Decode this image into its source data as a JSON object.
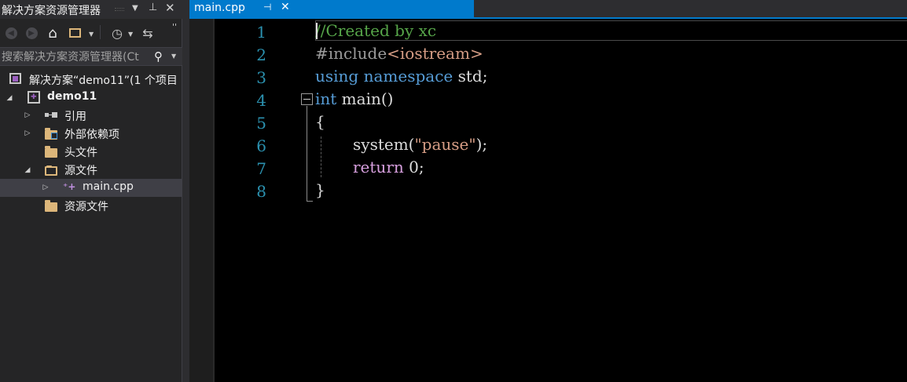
{
  "solution_explorer": {
    "title": "解决方案资源管理器",
    "search_placeholder": "搜索解决方案资源管理器(Ct",
    "tree": {
      "solution": "解决方案“demo11”(1 个项目",
      "project": "demo11",
      "references": "引用",
      "external_deps": "外部依赖项",
      "header_files": "头文件",
      "source_files": "源文件",
      "main_cpp": "main.cpp",
      "resource_files": "资源文件"
    }
  },
  "editor": {
    "tab_label": "main.cpp",
    "line_numbers": [
      "1",
      "2",
      "3",
      "4",
      "5",
      "6",
      "7",
      "8"
    ],
    "code": {
      "l1": "//Created by xc",
      "l2_directive": "#include",
      "l2_header": "<iostream>",
      "l3_using": "using",
      "l3_namespace": "namespace",
      "l3_rest": " std;",
      "l4_int": "int",
      "l4_rest": " main()",
      "l5": "{",
      "l6_call": "system(",
      "l6_str": "\"pause\"",
      "l6_end": ");",
      "l7_return": "return",
      "l7_rest": " 0;",
      "l8": "}"
    }
  },
  "icons": {
    "pin": "pin-icon",
    "close": "close-icon",
    "back": "back-icon",
    "forward": "forward-icon",
    "home": "home-icon",
    "history": "history-icon",
    "sync": "sync-icon",
    "search": "search-icon"
  },
  "colors": {
    "accent": "#007acc",
    "keyword": "#569cd6",
    "comment": "#57a64a",
    "string": "#d69d85",
    "control_keyword": "#d8a0df",
    "line_number": "#2b91af"
  }
}
